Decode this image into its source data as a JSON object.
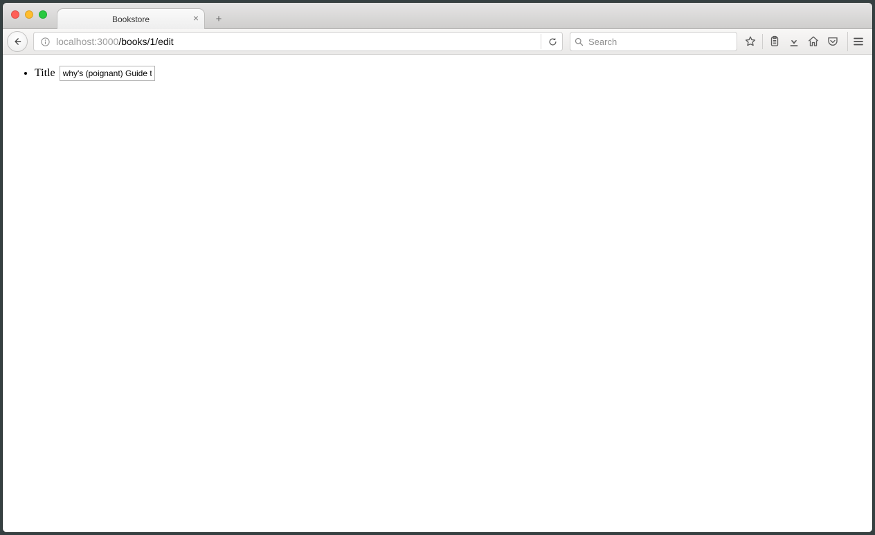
{
  "window": {
    "traffic_lights": [
      "close",
      "minimize",
      "zoom"
    ]
  },
  "tabs": {
    "active_title": "Bookstore"
  },
  "url": {
    "host_dim": "localhost",
    "port_dim": ":3000",
    "path": "/books/1/edit"
  },
  "search": {
    "placeholder": "Search"
  },
  "page": {
    "field_label": "Title",
    "title_value": "why's (poignant) Guide to"
  }
}
